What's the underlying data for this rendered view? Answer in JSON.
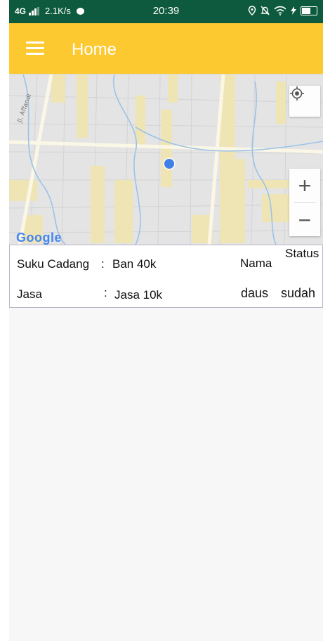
{
  "status_bar": {
    "network": "4G",
    "speed": "2.1K/s",
    "time": "20:39"
  },
  "app_bar": {
    "title": "Home"
  },
  "map": {
    "street_label": "Jl. Affandi",
    "logo_text": "Google",
    "zoom_in": "+",
    "zoom_out": "−"
  },
  "order": {
    "spare_part_label": "Suku Cadang",
    "spare_part_value": "Ban 40k",
    "service_label": "Jasa",
    "service_value": "Jasa 10k",
    "separator": ":",
    "name_label": "Nama",
    "name_value": "daus",
    "status_label": "Status",
    "status_value": "sudah"
  },
  "colors": {
    "status_bar": "#0e5a3e",
    "app_bar": "#fdc930",
    "location_dot": "#3f7fe8"
  }
}
